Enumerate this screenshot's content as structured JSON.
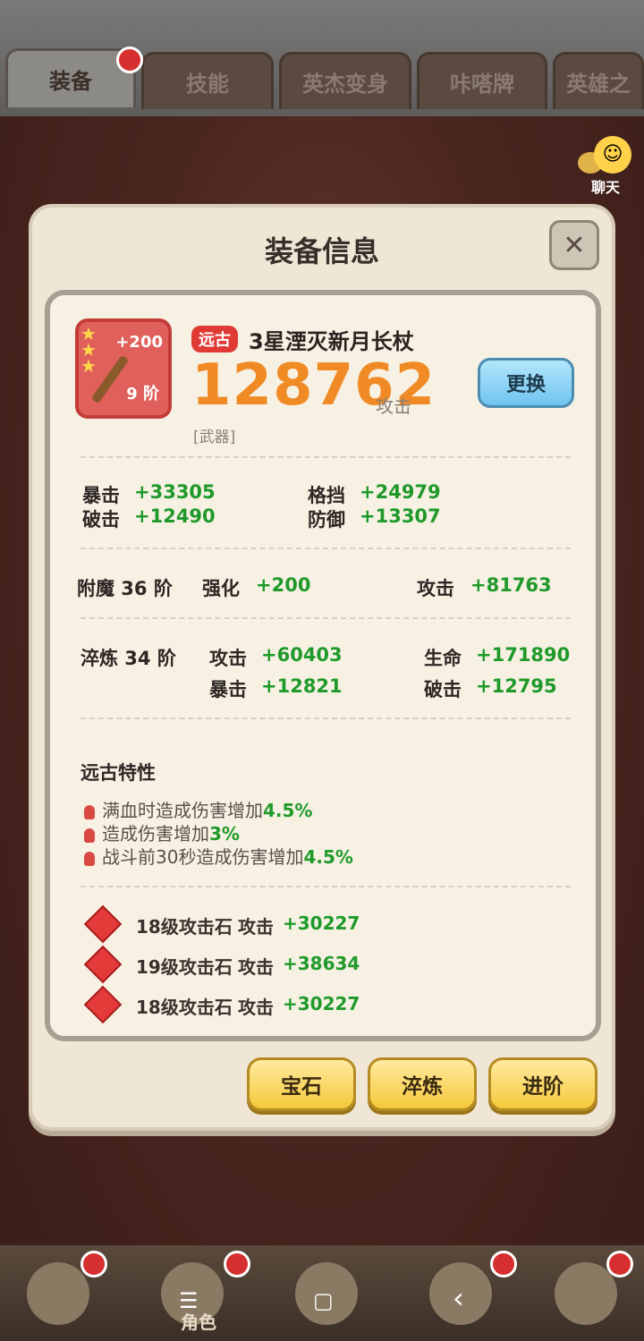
{
  "tabs": [
    {
      "label": "装备",
      "active": true
    },
    {
      "label": "技能",
      "active": false
    },
    {
      "label": "英杰变身",
      "active": false
    },
    {
      "label": "咔嗒牌",
      "active": false
    },
    {
      "label": "英雄之",
      "active": false
    }
  ],
  "chat": {
    "label": "聊天"
  },
  "dialog": {
    "title": "装备信息",
    "close_icon": "✕",
    "item": {
      "plus": "+200",
      "grade": "9 阶",
      "tag": "远古",
      "name": "3星湮灭新月长杖",
      "power": "128762",
      "power_label": "攻击",
      "type": "[武器]",
      "swap_label": "更换"
    },
    "base_stats": [
      {
        "label": "暴击",
        "value": "+33305"
      },
      {
        "label": "格挡",
        "value": "+24979"
      },
      {
        "label": "破击",
        "value": "+12490"
      },
      {
        "label": "防御",
        "value": "+13307"
      }
    ],
    "enchant": {
      "label": "附魔 36 阶",
      "strengthen_label": "强化",
      "strengthen_value": "+200",
      "attack_label": "攻击",
      "attack_value": "+81763"
    },
    "temper": {
      "label": "淬炼 34 阶",
      "stats": [
        {
          "label": "攻击",
          "value": "+60403"
        },
        {
          "label": "生命",
          "value": "+171890"
        },
        {
          "label": "暴击",
          "value": "+12821"
        },
        {
          "label": "破击",
          "value": "+12795"
        }
      ]
    },
    "traits": {
      "title": "远古特性",
      "items": [
        {
          "text": "满血时造成伤害增加",
          "value": "4.5%"
        },
        {
          "text": "造成伤害增加",
          "value": "3%"
        },
        {
          "text": "战斗前30秒造成伤害增加",
          "value": "4.5%"
        }
      ]
    },
    "gems": [
      {
        "name": "18级攻击石",
        "stat": "攻击",
        "value": "+30227"
      },
      {
        "name": "19级攻击石",
        "stat": "攻击",
        "value": "+38634"
      },
      {
        "name": "18级攻击石",
        "stat": "攻击",
        "value": "+30227"
      }
    ],
    "actions": [
      {
        "label": "宝石"
      },
      {
        "label": "淬炼"
      },
      {
        "label": "进阶"
      }
    ]
  },
  "bottom_nav": {
    "role_label": "角色",
    "system": {
      "menu": "☰",
      "home": "▢",
      "back": "‹"
    }
  },
  "colors": {
    "accent_orange": "#f08a24",
    "stat_green": "#1f9a2a",
    "tag_red": "#e03a35"
  }
}
